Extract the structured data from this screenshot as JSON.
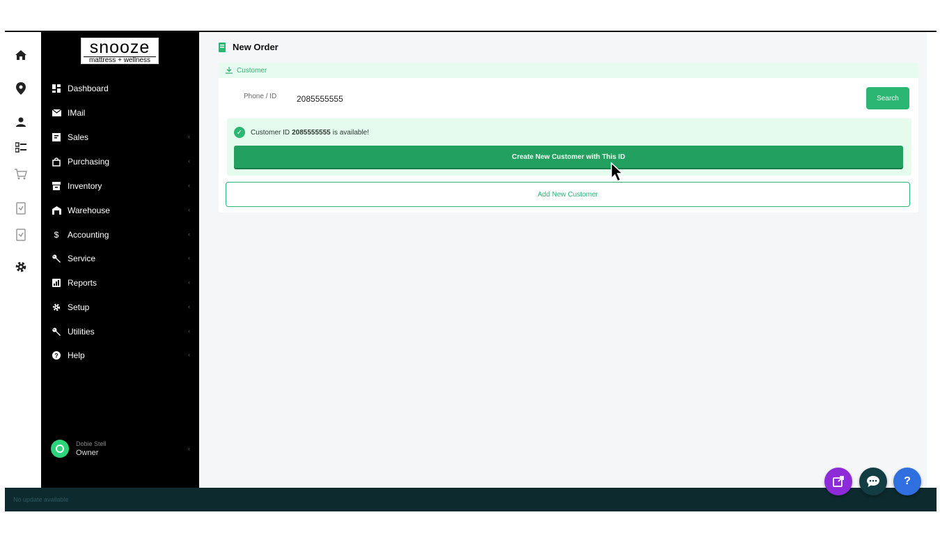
{
  "logo": {
    "line1": "snooze",
    "line2": "mattress + wellness"
  },
  "nav": [
    {
      "label": "Dashboard",
      "icon": "dashboard-icon",
      "chevron": false
    },
    {
      "label": "IMail",
      "icon": "mail-icon",
      "chevron": false
    },
    {
      "label": "Sales",
      "icon": "sales-icon",
      "chevron": true
    },
    {
      "label": "Purchasing",
      "icon": "shopping-bag-icon",
      "chevron": true
    },
    {
      "label": "Inventory",
      "icon": "inventory-icon",
      "chevron": true
    },
    {
      "label": "Warehouse",
      "icon": "warehouse-icon",
      "chevron": true
    },
    {
      "label": "Accounting",
      "icon": "dollar-icon",
      "chevron": true
    },
    {
      "label": "Service",
      "icon": "wrench-icon",
      "chevron": true
    },
    {
      "label": "Reports",
      "icon": "reports-icon",
      "chevron": true
    },
    {
      "label": "Setup",
      "icon": "gear-icon",
      "chevron": true
    },
    {
      "label": "Utilities",
      "icon": "wrench-icon",
      "chevron": true
    },
    {
      "label": "Help",
      "icon": "help-icon",
      "chevron": true
    }
  ],
  "user": {
    "name": "Dobie Stell",
    "role": "Owner"
  },
  "page": {
    "title": "New Order"
  },
  "customer_section": {
    "tab_label": "Customer",
    "phone_label": "Phone / ID",
    "phone_value": "2085555555",
    "search_label": "Search",
    "avail_prefix": "Customer ID",
    "avail_id": "2085555555",
    "avail_suffix": "is available!",
    "create_label": "Create New Customer with This ID",
    "add_label": "Add New Customer"
  },
  "footer": {
    "text": "No update available"
  },
  "colors": {
    "accent": "#2bb673",
    "sidebar": "#000000",
    "footer": "#0d2a2e",
    "fab_purple": "#8e2bd9",
    "fab_dark": "#123d43",
    "fab_blue": "#2f6fe0"
  }
}
